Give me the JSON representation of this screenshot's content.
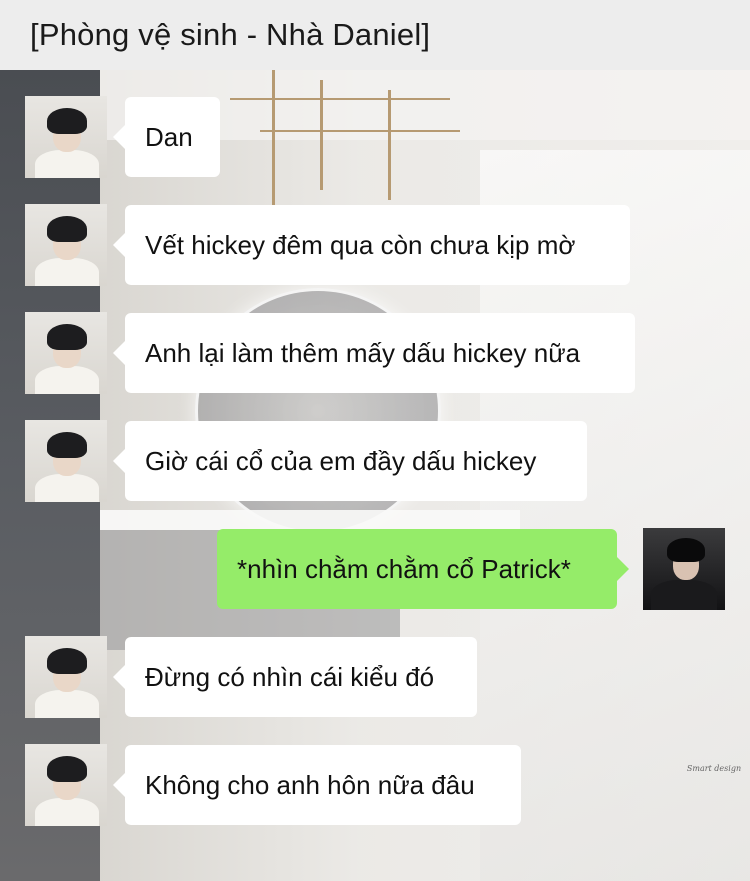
{
  "header": {
    "title": "[Phòng vệ sinh - Nhà Daniel]"
  },
  "colors": {
    "incoming_bubble": "#ffffff",
    "outgoing_bubble": "#95ec69",
    "header_bg": "#ededed"
  },
  "messages": [
    {
      "side": "left",
      "text": "Dan",
      "avatar": "daniel-avatar"
    },
    {
      "side": "left",
      "text": "Vết hickey đêm qua còn chưa kịp mờ",
      "avatar": "daniel-avatar"
    },
    {
      "side": "left",
      "text": "Anh lại làm thêm mấy dấu hickey nữa",
      "avatar": "daniel-avatar"
    },
    {
      "side": "left",
      "text": "Giờ cái cổ của em đầy dấu hickey",
      "avatar": "daniel-avatar"
    },
    {
      "side": "right",
      "text": "*nhìn chằm chằm cổ Patrick*",
      "avatar": "patrick-avatar"
    },
    {
      "side": "left",
      "text": "Đừng có nhìn cái kiểu đó",
      "avatar": "daniel-avatar"
    },
    {
      "side": "left",
      "text": "Không cho anh hôn nữa đâu",
      "avatar": "daniel-avatar"
    }
  ],
  "background": {
    "watermark": "Smart design"
  }
}
